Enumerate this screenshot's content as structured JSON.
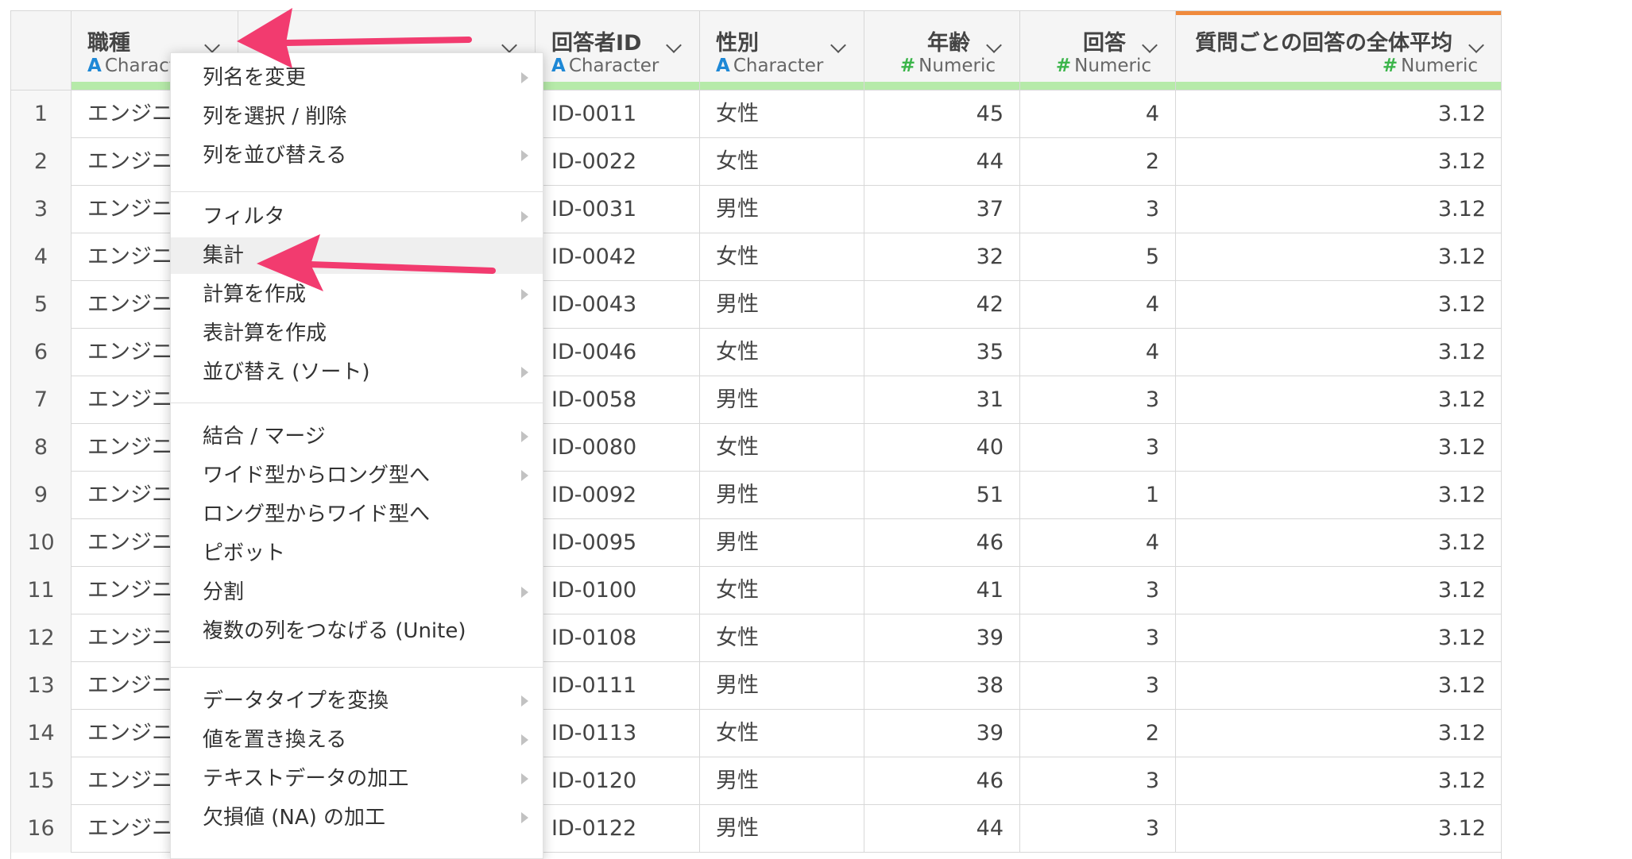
{
  "columns": [
    {
      "name": "職種",
      "type": "Character",
      "type_icon": "A"
    },
    {
      "name": "",
      "type": "",
      "type_icon": ""
    },
    {
      "name": "回答者ID",
      "type": "Character",
      "type_icon": "A"
    },
    {
      "name": "性別",
      "type": "Character",
      "type_icon": "A"
    },
    {
      "name": "年齢",
      "type": "Numeric",
      "type_icon": "#"
    },
    {
      "name": "回答",
      "type": "Numeric",
      "type_icon": "#"
    },
    {
      "name": "質問ごとの回答の全体平均",
      "type": "Numeric",
      "type_icon": "#"
    }
  ],
  "first_col_type_visible": "Charact",
  "rows": [
    {
      "n": "1",
      "job": "エンジニ",
      "id": "ID-0011",
      "sex": "女性",
      "age": "45",
      "answer": "4",
      "avg": "3.12"
    },
    {
      "n": "2",
      "job": "エンジニ",
      "id": "ID-0022",
      "sex": "女性",
      "age": "44",
      "answer": "2",
      "avg": "3.12"
    },
    {
      "n": "3",
      "job": "エンジニ",
      "id": "ID-0031",
      "sex": "男性",
      "age": "37",
      "answer": "3",
      "avg": "3.12"
    },
    {
      "n": "4",
      "job": "エンジニ",
      "id": "ID-0042",
      "sex": "女性",
      "age": "32",
      "answer": "5",
      "avg": "3.12"
    },
    {
      "n": "5",
      "job": "エンジニ",
      "id": "ID-0043",
      "sex": "男性",
      "age": "42",
      "answer": "4",
      "avg": "3.12"
    },
    {
      "n": "6",
      "job": "エンジニ",
      "id": "ID-0046",
      "sex": "女性",
      "age": "35",
      "answer": "4",
      "avg": "3.12"
    },
    {
      "n": "7",
      "job": "エンジニ",
      "id": "ID-0058",
      "sex": "男性",
      "age": "31",
      "answer": "3",
      "avg": "3.12"
    },
    {
      "n": "8",
      "job": "エンジニ",
      "id": "ID-0080",
      "sex": "女性",
      "age": "40",
      "answer": "3",
      "avg": "3.12"
    },
    {
      "n": "9",
      "job": "エンジニ",
      "id": "ID-0092",
      "sex": "男性",
      "age": "51",
      "answer": "1",
      "avg": "3.12"
    },
    {
      "n": "10",
      "job": "エンジニ",
      "id": "ID-0095",
      "sex": "男性",
      "age": "46",
      "answer": "4",
      "avg": "3.12"
    },
    {
      "n": "11",
      "job": "エンジニ",
      "id": "ID-0100",
      "sex": "女性",
      "age": "41",
      "answer": "3",
      "avg": "3.12"
    },
    {
      "n": "12",
      "job": "エンジニ",
      "id": "ID-0108",
      "sex": "女性",
      "age": "39",
      "answer": "3",
      "avg": "3.12"
    },
    {
      "n": "13",
      "job": "エンジニ",
      "id": "ID-0111",
      "sex": "男性",
      "age": "38",
      "answer": "3",
      "avg": "3.12"
    },
    {
      "n": "14",
      "job": "エンジニ",
      "id": "ID-0113",
      "sex": "女性",
      "age": "39",
      "answer": "2",
      "avg": "3.12"
    },
    {
      "n": "15",
      "job": "エンジニ",
      "id": "ID-0120",
      "sex": "男性",
      "age": "46",
      "answer": "3",
      "avg": "3.12"
    },
    {
      "n": "16",
      "job": "エンジニ",
      "id": "ID-0122",
      "sex": "男性",
      "age": "44",
      "answer": "3",
      "avg": "3.12"
    }
  ],
  "menu": {
    "groups": [
      [
        {
          "label": "列名を変更",
          "submenu": true
        },
        {
          "label": "列を選択 / 削除",
          "submenu": false
        },
        {
          "label": "列を並び替える",
          "submenu": true
        }
      ],
      [
        {
          "label": "フィルタ",
          "submenu": true
        },
        {
          "label": "集計",
          "submenu": false,
          "highlighted": true
        },
        {
          "label": "計算を作成",
          "submenu": true
        },
        {
          "label": "表計算を作成",
          "submenu": false
        },
        {
          "label": "並び替え (ソート)",
          "submenu": true
        }
      ],
      [
        {
          "label": "結合 / マージ",
          "submenu": true
        },
        {
          "label": "ワイド型からロング型へ",
          "submenu": true
        },
        {
          "label": "ロング型からワイド型へ",
          "submenu": false
        },
        {
          "label": "ピボット",
          "submenu": false
        },
        {
          "label": "分割",
          "submenu": true
        },
        {
          "label": "複数の列をつなげる (Unite)",
          "submenu": false
        }
      ],
      [
        {
          "label": "データタイプを変換",
          "submenu": true
        },
        {
          "label": "値を置き換える",
          "submenu": true
        },
        {
          "label": "テキストデータの加工",
          "submenu": true
        },
        {
          "label": "欠損値 (NA) の加工",
          "submenu": true
        }
      ]
    ]
  },
  "colors": {
    "accent_arrow": "#f23b6f",
    "type_character": "#1e88d6",
    "type_numeric": "#3bb54a",
    "header_stripe": "#b6eaa9",
    "active_column_bar": "#f08a3c"
  },
  "icons": {
    "column_menu": "chevron-down-icon",
    "submenu": "caret-right-icon",
    "annotation": "pink-arrow-icon"
  }
}
